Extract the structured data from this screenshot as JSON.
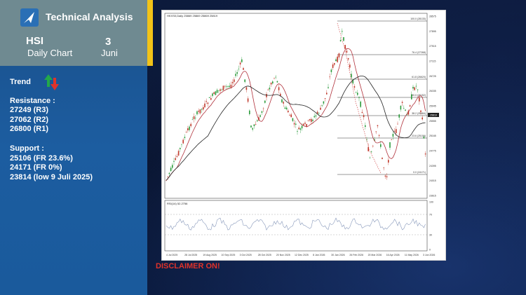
{
  "header": {
    "title": "Technical Analysis",
    "symbol": "HSI",
    "chart_type": "Daily Chart",
    "day": "3",
    "month": "Juni"
  },
  "trend": {
    "label": "Trend",
    "icon": "up-down-arrows-icon"
  },
  "resistance": {
    "title": "Resistance :",
    "levels": [
      "27249 (R3)",
      "27062 (R2)",
      "26800 (R1)"
    ]
  },
  "support": {
    "title": "Support :",
    "levels": [
      "25106 (FR 23.6%)",
      "24171 (FR 0%)",
      "23814 (low 9 Juli 2025)"
    ]
  },
  "disclaimer": "DISCLAIMER ON!",
  "colors": {
    "panel": "#1c5da0",
    "header": "#6f8a91",
    "accent": "#f2c318",
    "disclaimer": "#e0322a"
  },
  "chart": {
    "caption": "HKXS0,Daily 25869 25869 25869 25819",
    "last_price": "25819",
    "rsi_label": "RSI(14) 52.2756",
    "price_ticks": [
      "28575",
      "27895",
      "27515",
      "27115",
      "26725",
      "26335",
      "25945",
      "25555",
      "25165",
      "24775",
      "24395",
      "24015",
      "23615"
    ],
    "rsi_ticks": [
      "100",
      "70",
      "30",
      "0"
    ],
    "x_ticks": [
      "4 Jul 2025",
      "28 Jul 2025",
      "19 Aug 2025",
      "10 Sep 2025",
      "3 Oct 2025",
      "28 Oct 2025",
      "20 Nov 2025",
      "12 Dec 2025",
      "8 Jan 2026",
      "30 Jan 2026",
      "26 Feb 2026",
      "20 Mar 2026",
      "16 Apr 2026",
      "11 May 2026",
      "3 Jun 2026"
    ],
    "fib_levels": [
      {
        "label": "100.0 (28133)",
        "price": 28133
      },
      {
        "label": "76.4 (27268)",
        "price": 27268
      },
      {
        "label": "61.8 (26620)",
        "price": 26620
      },
      {
        "label": "50.0 (26152)",
        "price": 26152
      },
      {
        "label": "38.2 (25684)",
        "price": 25684
      },
      {
        "label": "23.6 (25106)",
        "price": 25106
      },
      {
        "label": "0.0 (24171)",
        "price": 24171
      }
    ]
  }
}
